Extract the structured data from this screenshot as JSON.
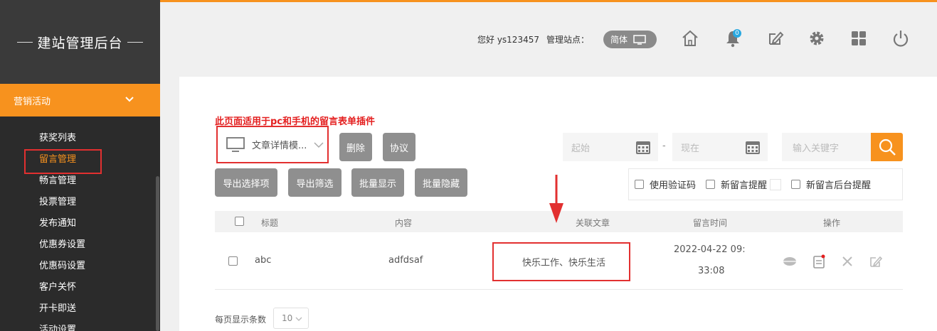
{
  "sidebar": {
    "brand": "建站管理后台",
    "section": "营销活动",
    "items": [
      {
        "label": "获奖列表",
        "active": false
      },
      {
        "label": "留言管理",
        "active": true
      },
      {
        "label": "畅言管理",
        "active": false
      },
      {
        "label": "投票管理",
        "active": false
      },
      {
        "label": "发布通知",
        "active": false
      },
      {
        "label": "优惠券设置",
        "active": false
      },
      {
        "label": "优惠码设置",
        "active": false
      },
      {
        "label": "客户关怀",
        "active": false
      },
      {
        "label": "开卡即送",
        "active": false
      },
      {
        "label": "活动设置",
        "active": false
      }
    ]
  },
  "topbar": {
    "greeting": "您好 ys123457",
    "site_label": "管理站点：",
    "lang": "简体",
    "notification_count": "0",
    "icons": [
      "home-icon",
      "bell-icon",
      "edit-icon",
      "gear-icon",
      "apps-icon",
      "power-icon"
    ],
    "accent": "#f7921e"
  },
  "main": {
    "notice": "此页面适用于pc和手机的留言表单插件",
    "template_select": "文章详情模...",
    "buttons": {
      "delete": "删除",
      "agreement": "协议",
      "export_selected": "导出选择项",
      "export_filtered": "导出筛选",
      "batch_show": "批量显示",
      "batch_hide": "批量隐藏"
    },
    "date_start_placeholder": "起始",
    "date_sep": "-",
    "date_end_placeholder": "现在",
    "search_placeholder": "输入关键字",
    "options": {
      "captcha": "使用验证码",
      "new_msg_alert": "新留言提醒",
      "new_msg_backend_alert": "新留言后台提醒"
    },
    "table": {
      "headers": {
        "title": "标题",
        "content": "内容",
        "article": "关联文章",
        "time": "留言时间",
        "action": "操作"
      },
      "rows": [
        {
          "title": "abc",
          "content": "adfdsaf",
          "article": "快乐工作、快乐生活",
          "time_line1": "2022-04-22 09:",
          "time_line2": "33:08"
        }
      ]
    },
    "pager": {
      "label": "每页显示条数",
      "value": "10"
    }
  }
}
